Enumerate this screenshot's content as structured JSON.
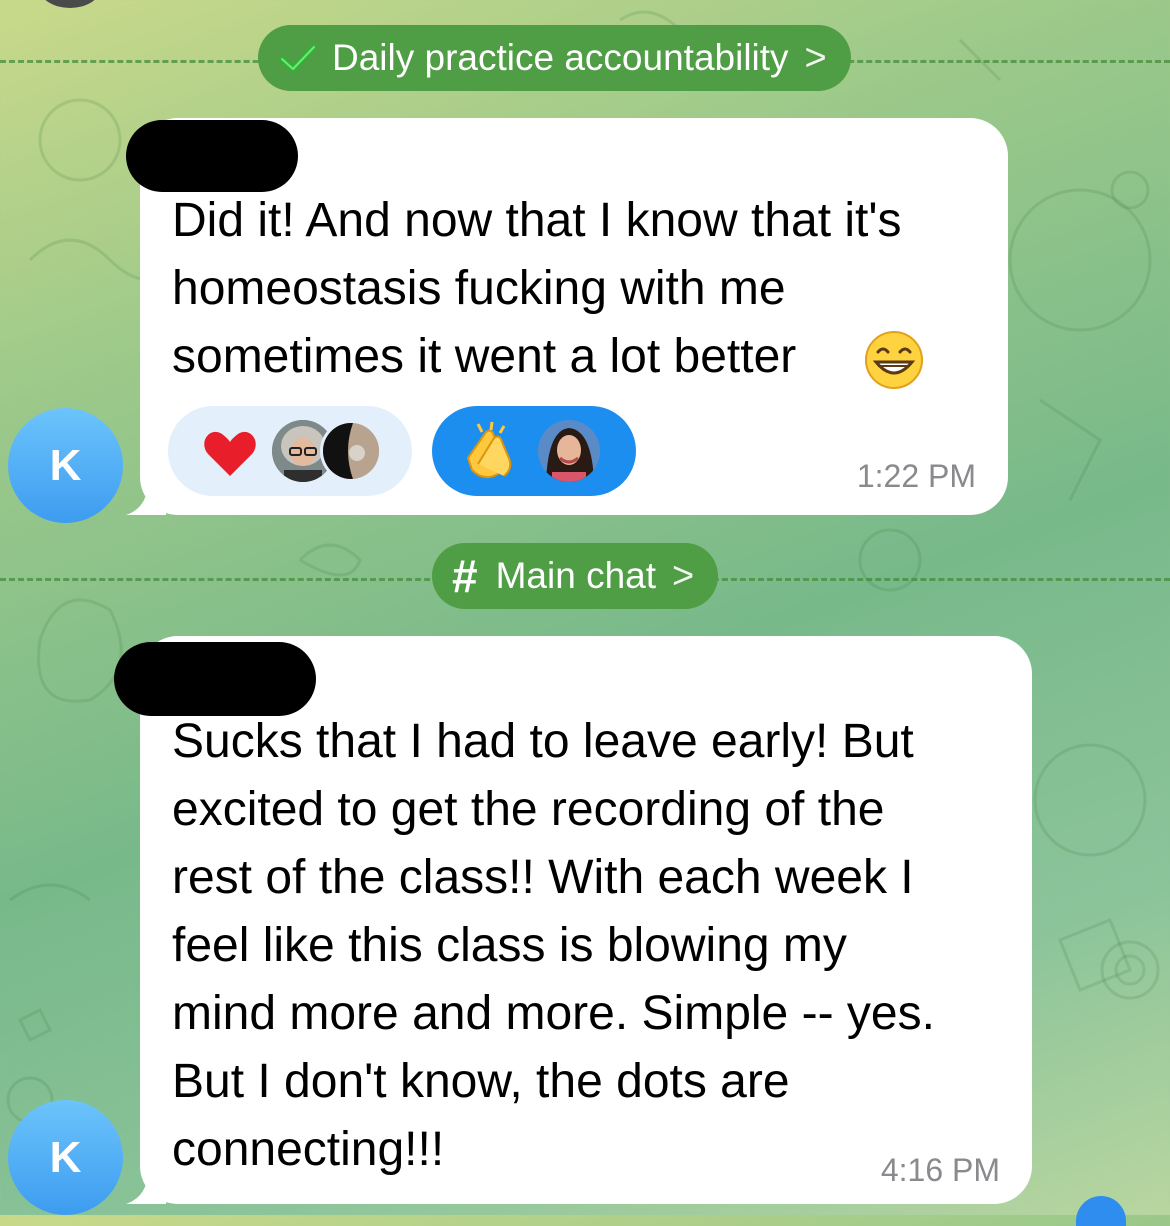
{
  "topics": [
    {
      "label": "Daily practice accountability",
      "icon": "check-icon",
      "chevron": ">"
    },
    {
      "label": "Main chat",
      "icon": "hash-icon",
      "icon_glyph": "#",
      "chevron": ">"
    }
  ],
  "messages": [
    {
      "avatar_initial": "K",
      "text": "Did it! And now that I know that it's\nhomeostasis fucking with me\nsometimes it went a lot better",
      "emoji": "grinning-face-icon",
      "time": "1:22 PM",
      "reactions": [
        {
          "emoji": "heart-icon",
          "style": "light",
          "reactors": 2
        },
        {
          "emoji": "clapping-hands-icon",
          "style": "blue",
          "reactors": 1
        }
      ]
    },
    {
      "avatar_initial": "K",
      "text": "Sucks that I had to leave early! But\nexcited to get the recording of the\nrest of the class!! With each week I\nfeel like this class is blowing my\nmind more and more. Simple -- yes.\nBut I don't know, the dots are\nconnecting!!!",
      "time": "4:16 PM"
    }
  ],
  "colors": {
    "topic_pill": "#4f9d44",
    "avatar_blue": "#3d9cf0",
    "reaction_blue": "#1c8ef0",
    "reaction_light": "#e3effb",
    "timestamp": "#8a8a8e"
  }
}
